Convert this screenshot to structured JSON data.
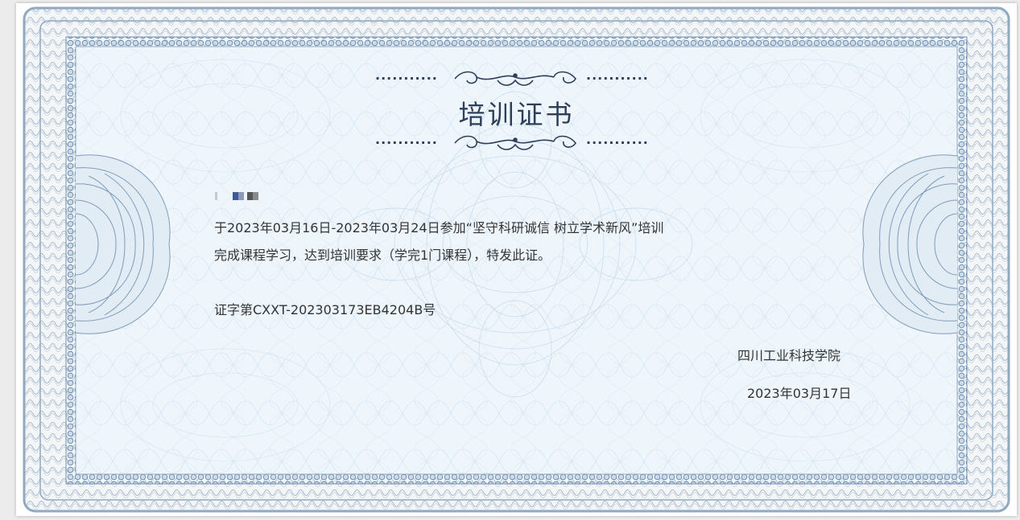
{
  "certificate": {
    "title": "培训证书",
    "recipient_redacted": true,
    "line1": "于2023年03月16日-2023年03月24日参加“坚守科研诚信 树立学术新风”培训",
    "line2": "完成课程学习，达到培训要求（学完1门课程），特发此证。",
    "certificate_number": "证字第CXXT-202303173EB4204B号",
    "issuer": "四川工业科技学院",
    "issue_date": "2023年03月17日",
    "divider_dots": "..........."
  },
  "colors": {
    "frame_blue": "#8fa9c2",
    "bead_blue": "#6f8fb0",
    "inner_bg": "#eef6fc",
    "title_color": "#2c3e58",
    "text_color": "#333333"
  }
}
